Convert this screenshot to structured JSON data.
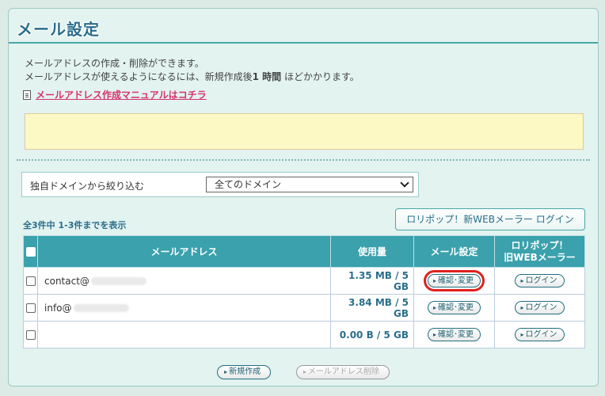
{
  "title": "メール設定",
  "description": {
    "line1": "メールアドレスの作成・削除ができます。",
    "line2_before": "メールアドレスが使えるようになるには、新規作成後",
    "line2_bold": "1 時間",
    "line2_after": " ほどかかります。"
  },
  "manual_link": "メールアドレス作成マニュアルはコチラ",
  "filter": {
    "label": "独自ドメインから絞り込む",
    "selected": "全てのドメイン"
  },
  "count_text": "全3件中 1-3件までを表示",
  "webmail_new_button": "ロリポップ！新WEBメーラー ログイン",
  "table": {
    "headers": {
      "address": "メールアドレス",
      "usage": "使用量",
      "settings": "メール設定",
      "old_webmail_line1": "ロリポップ！",
      "old_webmail_line2": "旧WEBメーラー"
    },
    "rows": [
      {
        "address": "contact@",
        "usage": "1.35 MB / 5 GB",
        "settings_btn": "確認･変更",
        "login_btn": "ログイン"
      },
      {
        "address": "info@",
        "usage": "3.84 MB / 5 GB",
        "settings_btn": "確認･変更",
        "login_btn": "ログイン"
      },
      {
        "address": "",
        "usage": "0.00 B / 5 GB",
        "settings_btn": "確認･変更",
        "login_btn": "ログイン"
      }
    ]
  },
  "bottom": {
    "new_button": "新規作成",
    "delete_button": "メールアドレス削除"
  },
  "colors": {
    "header_teal": "#3aa1ad",
    "title_blue": "#2a6e8c",
    "link_pink": "#d8336b",
    "notice_yellow": "#fdf9c4",
    "highlight_red": "#e02020"
  }
}
